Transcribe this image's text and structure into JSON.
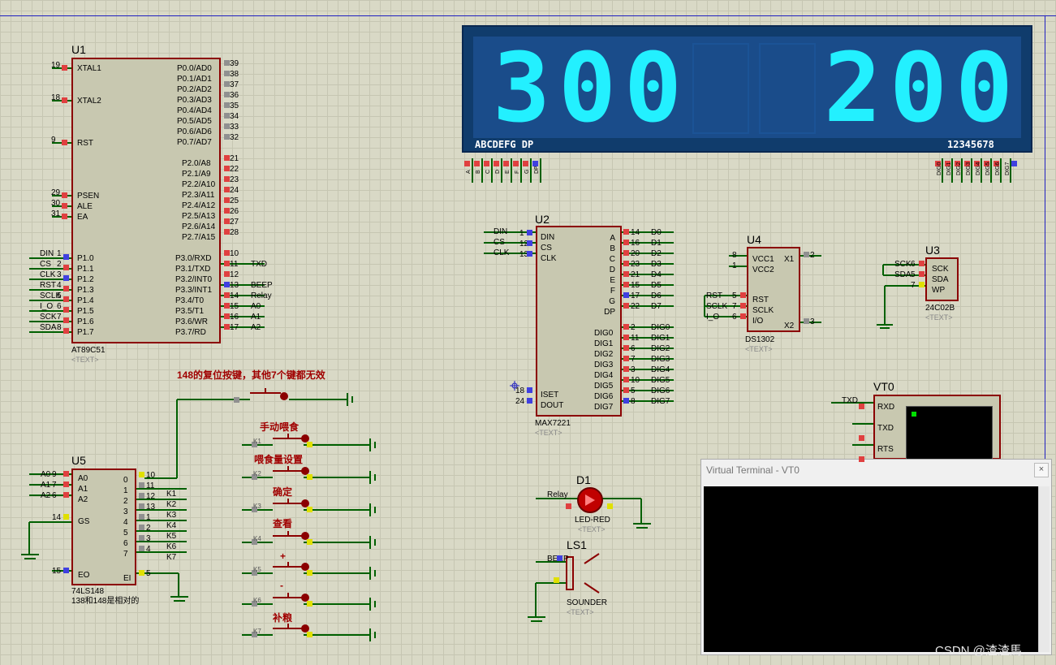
{
  "display": {
    "digits": [
      "3",
      "0",
      "0",
      "",
      "",
      "2",
      "0",
      "0"
    ],
    "segments_label": "ABCDEFG DP",
    "digits_label": "12345678",
    "seg_pins": [
      "A",
      "B",
      "C",
      "D",
      "E",
      "F",
      "G",
      "DP"
    ],
    "dig_pins": [
      "DIG0",
      "DIG1",
      "DIG2",
      "DIG3",
      "DIG4",
      "DIG5",
      "DIG6",
      "DIG7"
    ]
  },
  "u1": {
    "ref": "U1",
    "part": "AT89C51",
    "text_tag": "<TEXT>",
    "left_pins": [
      {
        "num": "19",
        "name": "XTAL1"
      },
      {
        "num": "18",
        "name": "XTAL2"
      },
      {
        "num": "9",
        "name": "RST"
      },
      {
        "num": "29",
        "name": "PSEN"
      },
      {
        "num": "30",
        "name": "ALE"
      },
      {
        "num": "31",
        "name": "EA"
      }
    ],
    "p1_pins": [
      {
        "net": "DIN",
        "num": "1",
        "name": "P1.0"
      },
      {
        "net": "CS",
        "num": "2",
        "name": "P1.1"
      },
      {
        "net": "CLK",
        "num": "3",
        "name": "P1.2"
      },
      {
        "net": "RST",
        "num": "4",
        "name": "P1.3"
      },
      {
        "net": "SCLK",
        "num": "5",
        "name": "P1.4"
      },
      {
        "net": "I_O",
        "num": "6",
        "name": "P1.5"
      },
      {
        "net": "SCK",
        "num": "7",
        "name": "P1.6"
      },
      {
        "net": "SDA",
        "num": "8",
        "name": "P1.7"
      }
    ],
    "p0_pins": [
      {
        "num": "39",
        "name": "P0.0/AD0"
      },
      {
        "num": "38",
        "name": "P0.1/AD1"
      },
      {
        "num": "37",
        "name": "P0.2/AD2"
      },
      {
        "num": "36",
        "name": "P0.3/AD3"
      },
      {
        "num": "35",
        "name": "P0.4/AD4"
      },
      {
        "num": "34",
        "name": "P0.5/AD5"
      },
      {
        "num": "33",
        "name": "P0.6/AD6"
      },
      {
        "num": "32",
        "name": "P0.7/AD7"
      }
    ],
    "p2_pins": [
      {
        "num": "21",
        "name": "P2.0/A8"
      },
      {
        "num": "22",
        "name": "P2.1/A9"
      },
      {
        "num": "23",
        "name": "P2.2/A10"
      },
      {
        "num": "24",
        "name": "P2.3/A11"
      },
      {
        "num": "25",
        "name": "P2.4/A12"
      },
      {
        "num": "26",
        "name": "P2.5/A13"
      },
      {
        "num": "27",
        "name": "P2.6/A14"
      },
      {
        "num": "28",
        "name": "P2.7/A15"
      }
    ],
    "p3_pins": [
      {
        "num": "10",
        "name": "P3.0/RXD",
        "net": ""
      },
      {
        "num": "11",
        "name": "P3.1/TXD",
        "net": "TXD"
      },
      {
        "num": "12",
        "name": "P3.2/INT0",
        "net": ""
      },
      {
        "num": "13",
        "name": "P3.3/INT1",
        "net": "BEEP"
      },
      {
        "num": "14",
        "name": "P3.4/T0",
        "net": "Relay"
      },
      {
        "num": "15",
        "name": "P3.5/T1",
        "net": "A0"
      },
      {
        "num": "16",
        "name": "P3.6/WR",
        "net": "A1"
      },
      {
        "num": "17",
        "name": "P3.7/RD",
        "net": "A2"
      }
    ]
  },
  "u2": {
    "ref": "U2",
    "part": "MAX7221",
    "text_tag": "<TEXT>",
    "left_pins": [
      {
        "net": "DIN",
        "num": "1",
        "name": "DIN"
      },
      {
        "net": "CS",
        "num": "12",
        "name": "CS"
      },
      {
        "net": "CLK",
        "num": "13",
        "name": "CLK"
      }
    ],
    "bottom_left": [
      {
        "num": "18",
        "name": "ISET"
      },
      {
        "num": "24",
        "name": "DOUT"
      }
    ],
    "seg_right": [
      {
        "num": "14",
        "name": "A",
        "net": "D0"
      },
      {
        "num": "16",
        "name": "B",
        "net": "D1"
      },
      {
        "num": "20",
        "name": "C",
        "net": "D2"
      },
      {
        "num": "23",
        "name": "D",
        "net": "D3"
      },
      {
        "num": "21",
        "name": "E",
        "net": "D4"
      },
      {
        "num": "15",
        "name": "F",
        "net": "D5"
      },
      {
        "num": "17",
        "name": "G",
        "net": "D6"
      },
      {
        "num": "22",
        "name": "DP",
        "net": "D7"
      }
    ],
    "dig_right": [
      {
        "num": "2",
        "name": "DIG0",
        "net": "DIG0"
      },
      {
        "num": "11",
        "name": "DIG1",
        "net": "DIG1"
      },
      {
        "num": "6",
        "name": "DIG2",
        "net": "DIG2"
      },
      {
        "num": "7",
        "name": "DIG3",
        "net": "DIG3"
      },
      {
        "num": "3",
        "name": "DIG4",
        "net": "DIG4"
      },
      {
        "num": "10",
        "name": "DIG5",
        "net": "DIG5"
      },
      {
        "num": "5",
        "name": "DIG6",
        "net": "DIG6"
      },
      {
        "num": "8",
        "name": "DIG7",
        "net": "DIG7"
      }
    ]
  },
  "u3": {
    "ref": "U3",
    "part": "24C02B",
    "text_tag": "<TEXT>",
    "pins": [
      {
        "net": "SCK",
        "num": "6",
        "name": "SCK"
      },
      {
        "net": "SDA",
        "num": "5",
        "name": "SDA"
      },
      {
        "net": "",
        "num": "7",
        "name": "WP"
      }
    ]
  },
  "u4": {
    "ref": "U4",
    "part": "DS1302",
    "text_tag": "<TEXT>",
    "left": [
      {
        "num": "8",
        "name": "VCC1"
      },
      {
        "num": "1",
        "name": "VCC2"
      },
      {
        "net": "RST",
        "num": "5",
        "name": "RST"
      },
      {
        "net": "SCLK",
        "num": "7",
        "name": "SCLK"
      },
      {
        "net": "I_O",
        "num": "6",
        "name": "I/O"
      }
    ],
    "right": [
      {
        "num": "2",
        "name": "X1"
      },
      {
        "num": "3",
        "name": "X2"
      }
    ]
  },
  "u5": {
    "ref": "U5",
    "part": "74LS148",
    "note": "138和148是相对的",
    "left": [
      {
        "net": "A0",
        "num": "9",
        "name": "A0"
      },
      {
        "net": "A1",
        "num": "7",
        "name": "A1"
      },
      {
        "net": "A2",
        "num": "6",
        "name": "A2"
      },
      {
        "net": "",
        "num": "14",
        "name": "GS"
      },
      {
        "net": "",
        "num": "15",
        "name": "EO"
      }
    ],
    "right": [
      {
        "num": "10",
        "name": "0",
        "net": ""
      },
      {
        "num": "11",
        "name": "1",
        "net": "K1"
      },
      {
        "num": "12",
        "name": "2",
        "net": "K2"
      },
      {
        "num": "13",
        "name": "3",
        "net": "K3"
      },
      {
        "num": "1",
        "name": "4",
        "net": "K4"
      },
      {
        "num": "2",
        "name": "5",
        "net": "K5"
      },
      {
        "num": "3",
        "name": "6",
        "net": "K6"
      },
      {
        "num": "4",
        "name": "7",
        "net": "K7"
      },
      {
        "num": "5",
        "name": "EI",
        "net": ""
      }
    ]
  },
  "note_reset": "148的复位按键，其他7个键都无效",
  "buttons": [
    {
      "label": "手动喂食",
      "net": "K1"
    },
    {
      "label": "喂食量设置",
      "net": "K2"
    },
    {
      "label": "确定",
      "net": "K3"
    },
    {
      "label": "查看",
      "net": "K4"
    },
    {
      "label": "+",
      "net": "K5"
    },
    {
      "label": "-",
      "net": "K6"
    },
    {
      "label": "补粮",
      "net": "K7"
    }
  ],
  "d1": {
    "ref": "D1",
    "part": "LED-RED",
    "net": "Relay",
    "text_tag": "<TEXT>"
  },
  "ls1": {
    "ref": "LS1",
    "part": "SOUNDER",
    "net": "BEEP",
    "text_tag": "<TEXT>"
  },
  "vt0": {
    "ref": "VT0",
    "pins": [
      {
        "net": "TXD",
        "name": "RXD"
      },
      {
        "net": "",
        "name": "TXD"
      },
      {
        "net": "",
        "name": "RTS"
      }
    ]
  },
  "terminal": {
    "title": "Virtual Terminal - VT0",
    "close": "×"
  },
  "watermark": "CSDN @渣渣馬"
}
